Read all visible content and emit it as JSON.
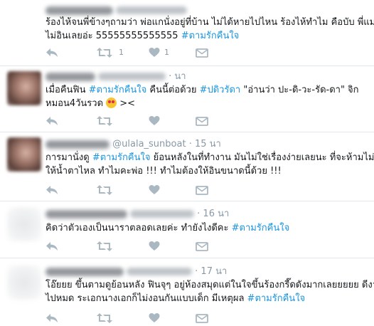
{
  "tweets": [
    {
      "header": {
        "name": "",
        "handle": "",
        "sep": "·",
        "time": ""
      },
      "lines": [
        [
          {
            "t": "ร้องไห้จนพี่ข้างๆถามว่า พ่อแกนั่งอยู่ที่บ้าน ไม่ได้หายไปไหน ร้องไห้ทำไม คือบับ พี่แม่ง"
          }
        ],
        [
          {
            "t": "ไม่อินเลยอ่ะ 55555555555555 "
          },
          {
            "t": "#ตามรักคืนใจ",
            "tag": true
          }
        ]
      ],
      "retweets": "1",
      "likes": "1"
    },
    {
      "header": {
        "name": "",
        "handle": "",
        "sep": "·",
        "time": "นา"
      },
      "lines": [
        [
          {
            "t": "เมื่อคืนฟิน "
          },
          {
            "t": "#ตามรักคืนใจ",
            "tag": true
          },
          {
            "t": " คืนนี้ต่อด้วย "
          },
          {
            "t": "#ปดิวรัดา",
            "tag": true
          },
          {
            "t": " \"อ่านว่า ปะ-ดิ-วะ-รัด-ดา\" จิก"
          }
        ],
        [
          {
            "t": "หมอน4วันรวด "
          },
          {
            "t": "",
            "emoji": true
          },
          {
            "t": " ><"
          }
        ]
      ],
      "retweets": "",
      "likes": ""
    },
    {
      "header": {
        "name": "",
        "handle": "@ulala_sunboat",
        "sep": "·",
        "time": "15 นา"
      },
      "lines": [
        [
          {
            "t": "การมานั่งดู "
          },
          {
            "t": "#ตามรักคืนใจ",
            "tag": true
          },
          {
            "t": " ย้อนหลังในที่ทำงาน  มันไม่ใช่เรื่องง่ายเลยนะ ที่จะห้ามไม่"
          }
        ],
        [
          {
            "t": "ให้น้ำตาไหล ทำไมคะพ่อ !!! ทำไมต้องให้อินขนาดนี้ด้วย !!!"
          }
        ]
      ],
      "retweets": "",
      "likes": ""
    },
    {
      "header": {
        "name": "",
        "handle": "",
        "sep": "·",
        "time": "16 นา"
      },
      "lines": [
        [
          {
            "t": "คิดว่าตัวเองเป็นนาราตลอดเลยค่ะ ทำยังไงดีคะ "
          },
          {
            "t": "#ตามรักคืนใจ",
            "tag": true
          }
        ]
      ],
      "retweets": "",
      "likes": ""
    },
    {
      "header": {
        "name": "",
        "handle": "",
        "sep": "·",
        "time": "17 นา"
      },
      "lines": [
        [
          {
            "t": "โอ๊ยยย ขึ้นตามดูย้อนหลัง ฟินจุๆ อยู่ห้องสมุดแต่ในใจขึ้นร้องกรี๊ดดังมากเลยยยยย ดีงาม"
          }
        ],
        [
          {
            "t": "ไปหมด ระเอกนางเอกก็ไม่งอนกันแบบเด็ก มีเหตุผล "
          },
          {
            "t": "#ตามรักคืนใจ",
            "tag": true
          }
        ]
      ],
      "retweets": "",
      "likes": ""
    }
  ],
  "colors": {
    "hashtag": "#1b95e0",
    "action_icon": "#aab8c2",
    "divider": "#e1e8ed"
  },
  "icons": [
    "reply-icon",
    "retweet-icon",
    "like-icon",
    "dm-icon"
  ]
}
